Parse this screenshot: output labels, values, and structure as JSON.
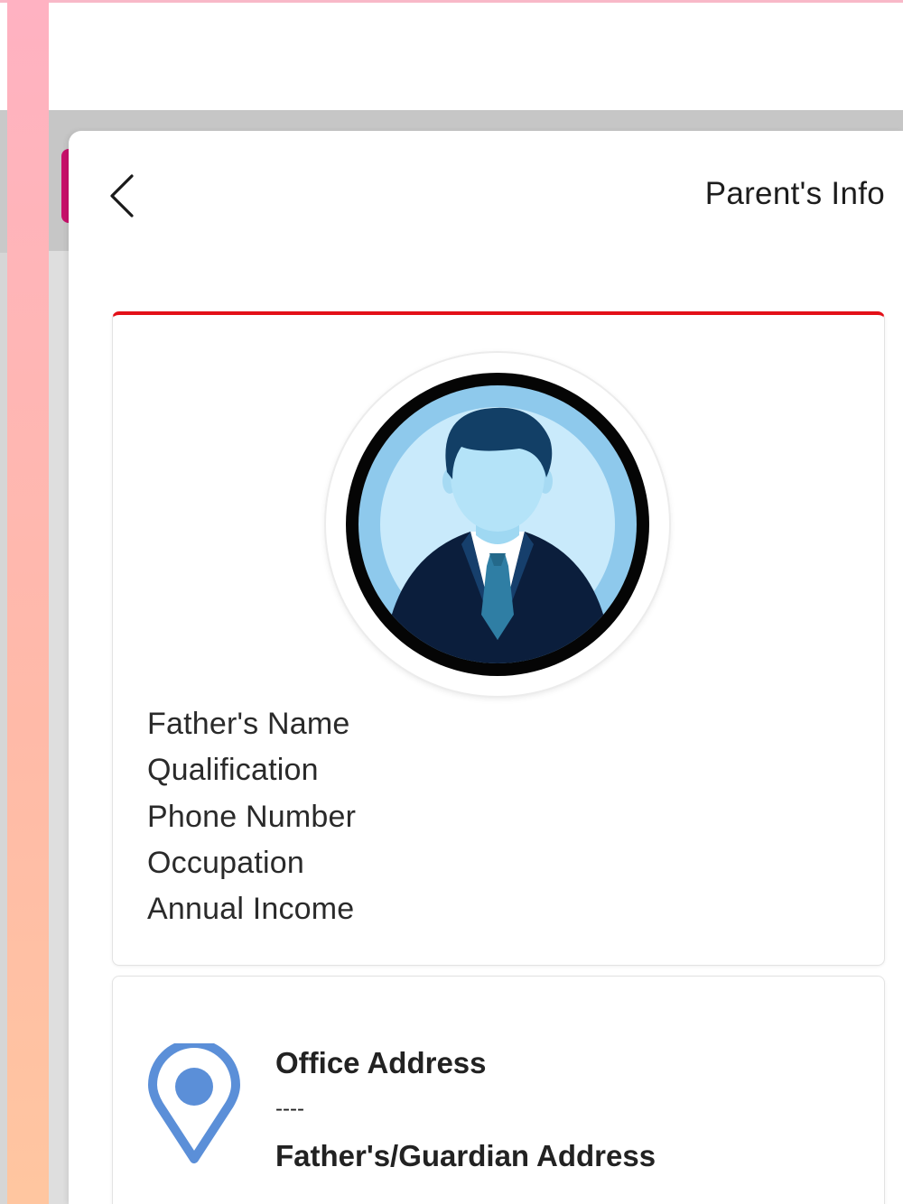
{
  "header": {
    "title": "Parent's Info"
  },
  "profile": {
    "fields": [
      {
        "label": "Father's Name",
        "value": ""
      },
      {
        "label": "Qualification",
        "value": ""
      },
      {
        "label": "Phone Number",
        "value": ""
      },
      {
        "label": "Occupation",
        "value": ""
      },
      {
        "label": "Annual Income",
        "value": ""
      }
    ]
  },
  "address": {
    "office_heading": "Office Address",
    "office_value": "----",
    "home_heading": "Father's/Guardian Address"
  },
  "colors": {
    "accent_red": "#e31018",
    "pin_blue": "#5b8fd8",
    "side_pink": "#ffb2c2",
    "tab_magenta": "#c8106a"
  },
  "icons": {
    "back": "chevron-left-icon",
    "avatar": "businessman-avatar-icon",
    "location": "location-pin-icon"
  }
}
